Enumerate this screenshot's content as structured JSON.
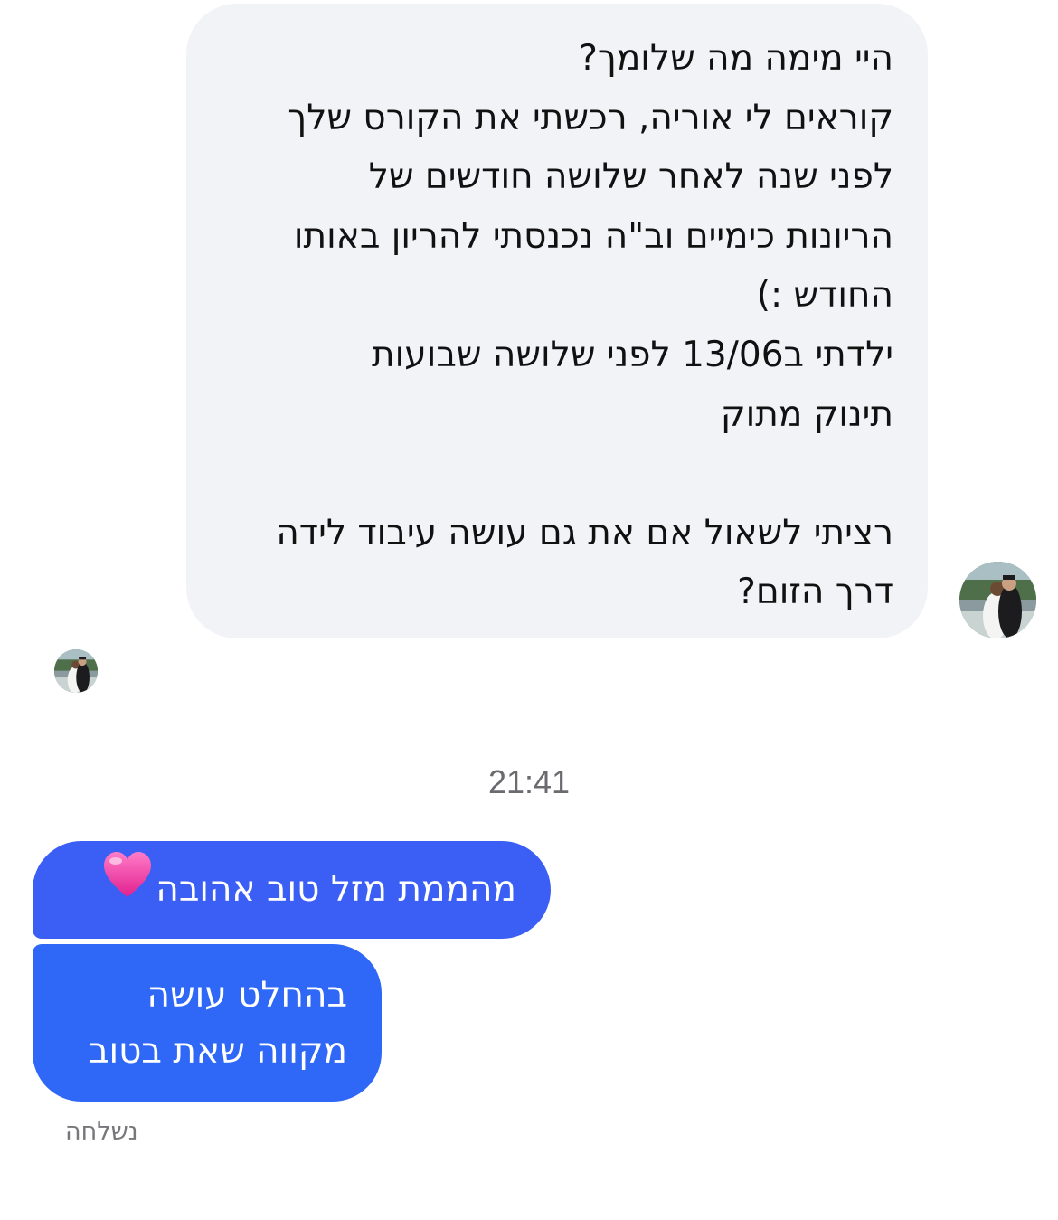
{
  "conversation": {
    "incoming_message": {
      "lines": [
        "היי מימה מה שלומך?",
        "קוראים לי אוריה, רכשתי את הקורס שלך",
        "לפני שנה לאחר שלושה חודשים של",
        "הריונות כימיים וב\"ה נכנסתי להריון באותו",
        "החודש :)",
        "ילדתי ב13/06 לפני שלושה שבועות",
        "תינוק מתוק",
        "",
        "רציתי לשאול אם את גם עושה עיבוד לידה",
        "דרך הזום?"
      ]
    },
    "timestamp": "21:41",
    "outgoing_messages": [
      {
        "text": "מהממת מזל טוב אהובה",
        "emoji": "heart-icon"
      },
      {
        "lines": [
          "בהחלט עושה",
          "מקווה שאת בטוב"
        ]
      }
    ],
    "status": "נשלחה"
  },
  "colors": {
    "incoming_bubble": "#f2f3f7",
    "outgoing_bubble_1": "#3b5ff5",
    "outgoing_bubble_2": "#2f68f7",
    "timestamp_text": "#6b6b6f",
    "heart": "#f24aa8"
  }
}
